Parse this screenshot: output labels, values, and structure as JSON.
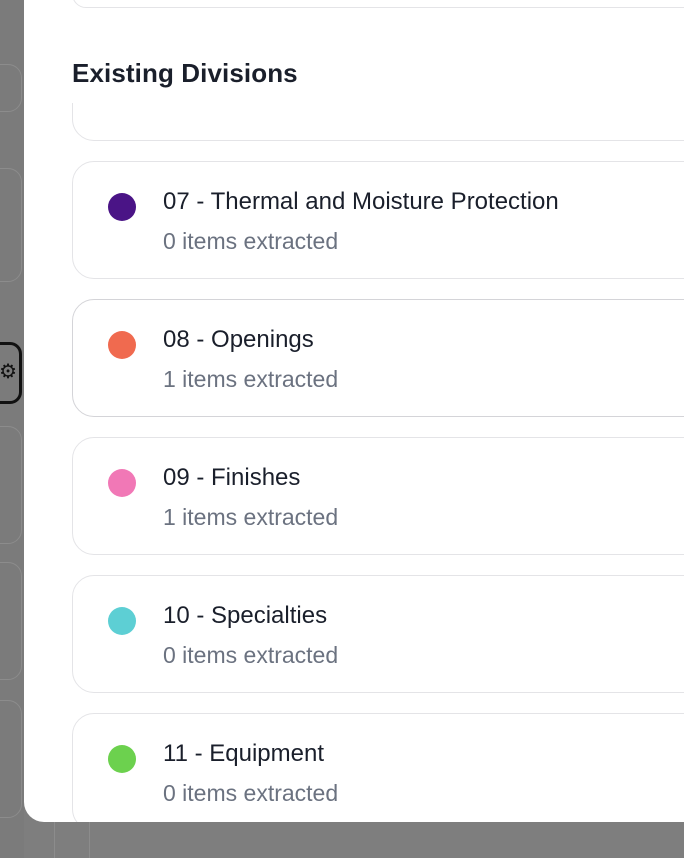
{
  "section": {
    "title": "Existing Divisions"
  },
  "divisions": [
    {
      "name": "07 - Thermal and Moisture Protection",
      "count": "0 items extracted",
      "color": "#4a1486"
    },
    {
      "name": "08 - Openings",
      "count": "1 items extracted",
      "color": "#f06a4f"
    },
    {
      "name": "09 - Finishes",
      "count": "1 items extracted",
      "color": "#f178b6"
    },
    {
      "name": "10 - Specialties",
      "count": "0 items extracted",
      "color": "#5dcfd4"
    },
    {
      "name": "11 - Equipment",
      "count": "0 items extracted",
      "color": "#6cd14e"
    }
  ],
  "background": {
    "gear_icon": "gear-icon",
    "gear_glyph": "⚙"
  }
}
